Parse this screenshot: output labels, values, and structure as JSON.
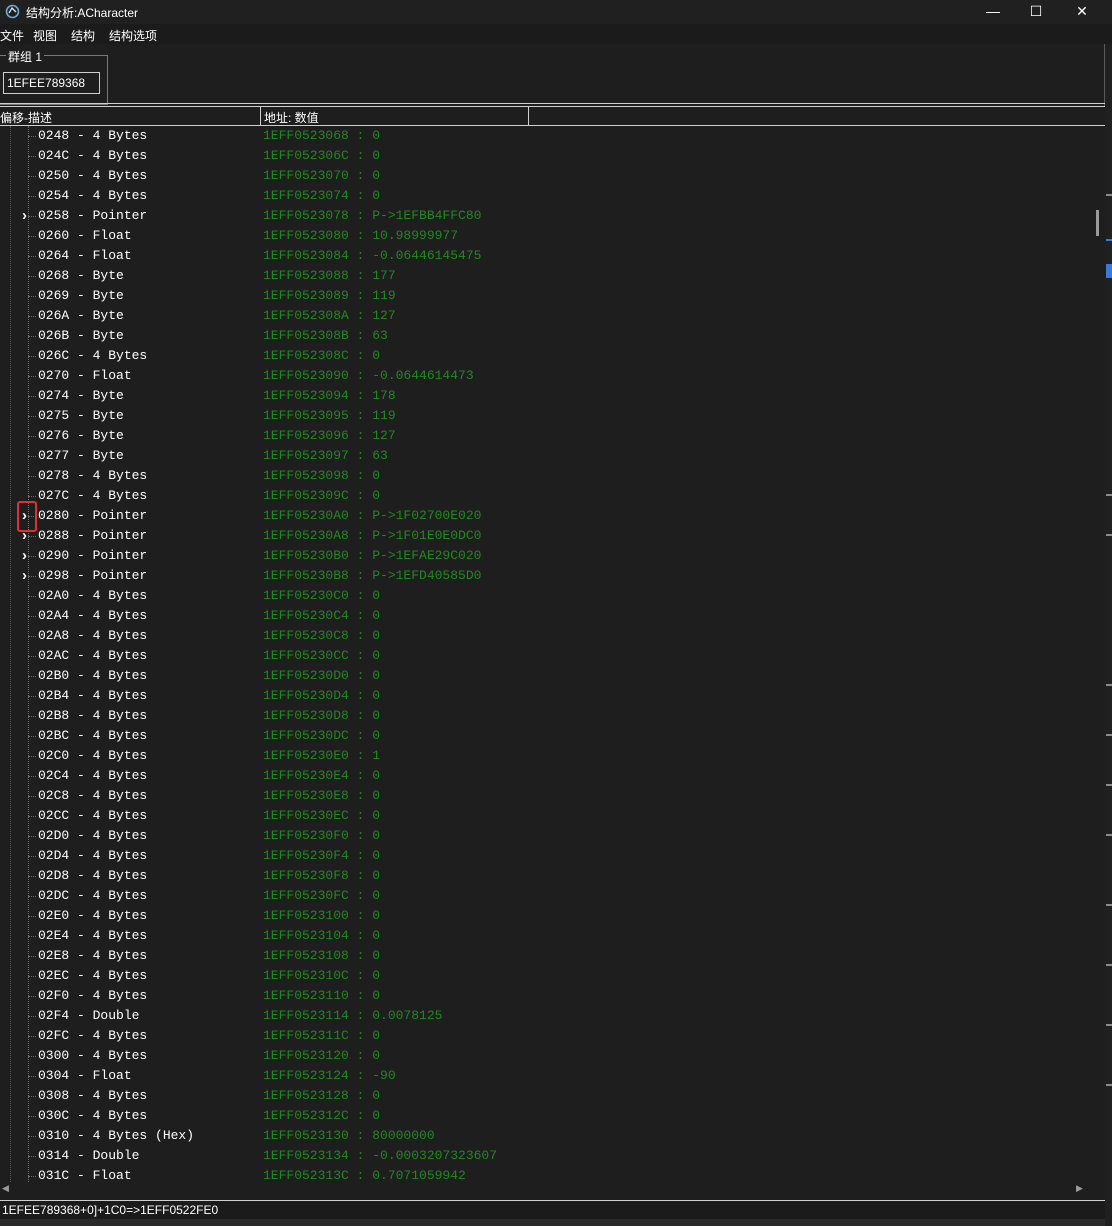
{
  "window": {
    "title": "结构分析:ACharacter",
    "app_icon": "cheat-engine-icon",
    "min_glyph": "—",
    "max_glyph": "☐",
    "close_glyph": "✕"
  },
  "menu": [
    "文件",
    "视图",
    "结构",
    "结构选项"
  ],
  "group": {
    "label": "群组 1",
    "address": "1EFEE789368"
  },
  "columns": {
    "offset_desc": "偏移-描述",
    "address_value": "地址: 数值"
  },
  "rows": [
    {
      "entry": "0248 - 4 Bytes",
      "value": "1EFF0523068 : 0",
      "expand": false
    },
    {
      "entry": "024C - 4 Bytes",
      "value": "1EFF052306C : 0",
      "expand": false
    },
    {
      "entry": "0250 - 4 Bytes",
      "value": "1EFF0523070 : 0",
      "expand": false
    },
    {
      "entry": "0254 - 4 Bytes",
      "value": "1EFF0523074 : 0",
      "expand": false
    },
    {
      "entry": "0258 - Pointer",
      "value": "1EFF0523078 : P->1EFBB4FFC80",
      "expand": true
    },
    {
      "entry": "0260 - Float",
      "value": "1EFF0523080 : 10.98999977",
      "expand": false
    },
    {
      "entry": "0264 - Float",
      "value": "1EFF0523084 : -0.06446145475",
      "expand": false
    },
    {
      "entry": "0268 - Byte",
      "value": "1EFF0523088 : 177",
      "expand": false
    },
    {
      "entry": "0269 - Byte",
      "value": "1EFF0523089 : 119",
      "expand": false
    },
    {
      "entry": "026A - Byte",
      "value": "1EFF052308A : 127",
      "expand": false
    },
    {
      "entry": "026B - Byte",
      "value": "1EFF052308B : 63",
      "expand": false
    },
    {
      "entry": "026C - 4 Bytes",
      "value": "1EFF052308C : 0",
      "expand": false
    },
    {
      "entry": "0270 - Float",
      "value": "1EFF0523090 : -0.0644614473",
      "expand": false
    },
    {
      "entry": "0274 - Byte",
      "value": "1EFF0523094 : 178",
      "expand": false
    },
    {
      "entry": "0275 - Byte",
      "value": "1EFF0523095 : 119",
      "expand": false
    },
    {
      "entry": "0276 - Byte",
      "value": "1EFF0523096 : 127",
      "expand": false
    },
    {
      "entry": "0277 - Byte",
      "value": "1EFF0523097 : 63",
      "expand": false
    },
    {
      "entry": "0278 - 4 Bytes",
      "value": "1EFF0523098 : 0",
      "expand": false
    },
    {
      "entry": "027C - 4 Bytes",
      "value": "1EFF052309C : 0",
      "expand": false
    },
    {
      "entry": "0280 - Pointer",
      "value": "1EFF05230A0 : P->1F02700E020",
      "expand": true
    },
    {
      "entry": "0288 - Pointer",
      "value": "1EFF05230A8 : P->1F01E0E0DC0",
      "expand": true
    },
    {
      "entry": "0290 - Pointer",
      "value": "1EFF05230B0 : P->1EFAE29C020",
      "expand": true
    },
    {
      "entry": "0298 - Pointer",
      "value": "1EFF05230B8 : P->1EFD40585D0",
      "expand": true
    },
    {
      "entry": "02A0 - 4 Bytes",
      "value": "1EFF05230C0 : 0",
      "expand": false
    },
    {
      "entry": "02A4 - 4 Bytes",
      "value": "1EFF05230C4 : 0",
      "expand": false
    },
    {
      "entry": "02A8 - 4 Bytes",
      "value": "1EFF05230C8 : 0",
      "expand": false
    },
    {
      "entry": "02AC - 4 Bytes",
      "value": "1EFF05230CC : 0",
      "expand": false
    },
    {
      "entry": "02B0 - 4 Bytes",
      "value": "1EFF05230D0 : 0",
      "expand": false
    },
    {
      "entry": "02B4 - 4 Bytes",
      "value": "1EFF05230D4 : 0",
      "expand": false
    },
    {
      "entry": "02B8 - 4 Bytes",
      "value": "1EFF05230D8 : 0",
      "expand": false
    },
    {
      "entry": "02BC - 4 Bytes",
      "value": "1EFF05230DC : 0",
      "expand": false
    },
    {
      "entry": "02C0 - 4 Bytes",
      "value": "1EFF05230E0 : 1",
      "expand": false
    },
    {
      "entry": "02C4 - 4 Bytes",
      "value": "1EFF05230E4 : 0",
      "expand": false
    },
    {
      "entry": "02C8 - 4 Bytes",
      "value": "1EFF05230E8 : 0",
      "expand": false
    },
    {
      "entry": "02CC - 4 Bytes",
      "value": "1EFF05230EC : 0",
      "expand": false
    },
    {
      "entry": "02D0 - 4 Bytes",
      "value": "1EFF05230F0 : 0",
      "expand": false
    },
    {
      "entry": "02D4 - 4 Bytes",
      "value": "1EFF05230F4 : 0",
      "expand": false
    },
    {
      "entry": "02D8 - 4 Bytes",
      "value": "1EFF05230F8 : 0",
      "expand": false
    },
    {
      "entry": "02DC - 4 Bytes",
      "value": "1EFF05230FC : 0",
      "expand": false
    },
    {
      "entry": "02E0 - 4 Bytes",
      "value": "1EFF0523100 : 0",
      "expand": false
    },
    {
      "entry": "02E4 - 4 Bytes",
      "value": "1EFF0523104 : 0",
      "expand": false
    },
    {
      "entry": "02E8 - 4 Bytes",
      "value": "1EFF0523108 : 0",
      "expand": false
    },
    {
      "entry": "02EC - 4 Bytes",
      "value": "1EFF052310C : 0",
      "expand": false
    },
    {
      "entry": "02F0 - 4 Bytes",
      "value": "1EFF0523110 : 0",
      "expand": false
    },
    {
      "entry": "02F4 - Double",
      "value": "1EFF0523114 : 0.0078125",
      "expand": false
    },
    {
      "entry": "02FC - 4 Bytes",
      "value": "1EFF052311C : 0",
      "expand": false
    },
    {
      "entry": "0300 - 4 Bytes",
      "value": "1EFF0523120 : 0",
      "expand": false
    },
    {
      "entry": "0304 - Float",
      "value": "1EFF0523124 : -90",
      "expand": false
    },
    {
      "entry": "0308 - 4 Bytes",
      "value": "1EFF0523128 : 0",
      "expand": false
    },
    {
      "entry": "030C - 4 Bytes",
      "value": "1EFF052312C : 0",
      "expand": false
    },
    {
      "entry": "0310 - 4 Bytes (Hex)",
      "value": "1EFF0523130 : 80000000",
      "expand": false
    },
    {
      "entry": "0314 - Double",
      "value": "1EFF0523134 : -0.0003207323607",
      "expand": false
    },
    {
      "entry": "031C - Float",
      "value": "1EFF052313C : 0.7071059942",
      "expand": false
    }
  ],
  "status": "1EFEE789368+0]+1C0=>1EFF0522FE0",
  "colors": {
    "background": "#1e1e1e",
    "text": "#ffffff",
    "value_text": "#1e8a1e",
    "highlight": "#e03030"
  }
}
